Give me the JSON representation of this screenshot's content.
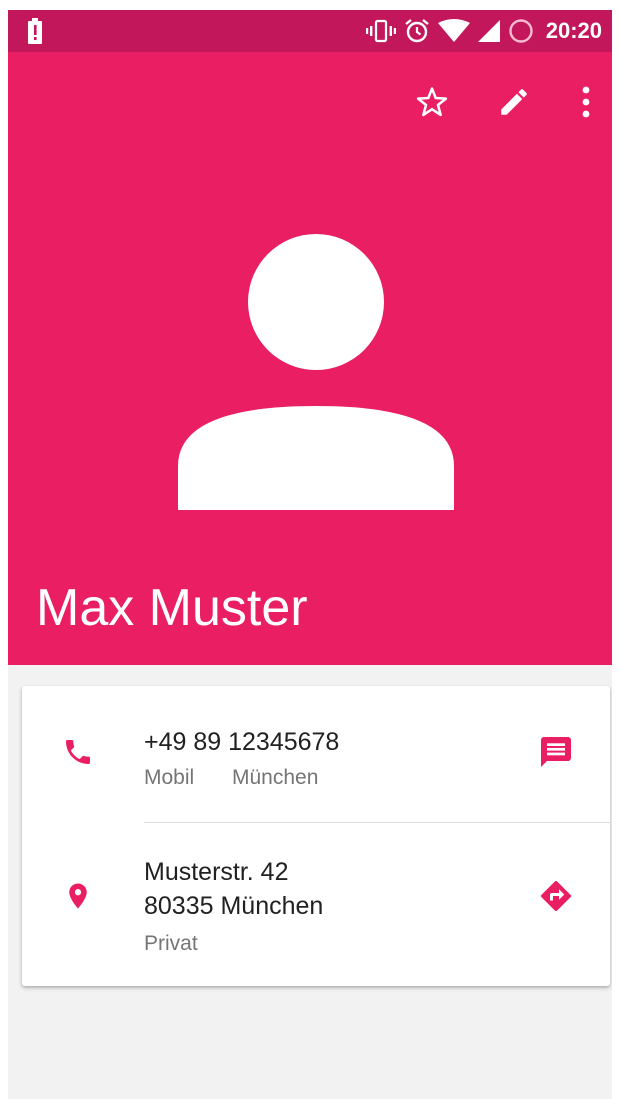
{
  "colors": {
    "accent": "#e91e63",
    "status_bar": "#c2185b",
    "background": "#f2f2f2",
    "primary_text": "#212121",
    "secondary_text": "#757575"
  },
  "status_bar": {
    "time": "20:20",
    "icons": [
      "battery-alert-icon",
      "vibrate-icon",
      "alarm-icon",
      "wifi-icon",
      "signal-icon",
      "sync-circle-icon"
    ]
  },
  "toolbar": {
    "icons": [
      "star-outline-icon",
      "edit-pencil-icon",
      "more-vert-icon"
    ]
  },
  "contact": {
    "name": "Max Muster",
    "avatar_icon": "person-icon"
  },
  "phone": {
    "number": "+49 89 12345678",
    "type": "Mobil",
    "location": "München",
    "icon": "phone-icon",
    "action_icon": "message-icon"
  },
  "address": {
    "line1": "Musterstr. 42",
    "line2": "80335 München",
    "type": "Privat",
    "icon": "location-pin-icon",
    "action_icon": "directions-icon"
  }
}
